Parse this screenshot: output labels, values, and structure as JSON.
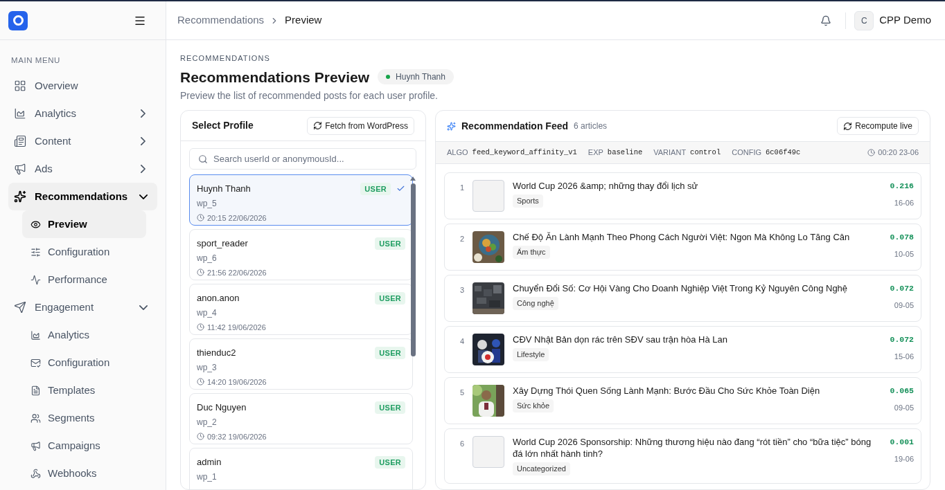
{
  "topbar": {
    "breadcrumbs": [
      {
        "label": "Recommendations",
        "current": false
      },
      {
        "label": "Preview",
        "current": true
      }
    ],
    "avatar_initial": "C",
    "user_name": "CPP Demo"
  },
  "sidebar": {
    "section_title": "MAIN MENU",
    "items": [
      {
        "label": "Overview",
        "kind": "link",
        "selected": false
      },
      {
        "label": "Analytics",
        "kind": "group",
        "expanded": false,
        "selected": false
      },
      {
        "label": "Content",
        "kind": "group",
        "expanded": false,
        "selected": false
      },
      {
        "label": "Ads",
        "kind": "group",
        "expanded": false,
        "selected": false
      },
      {
        "label": "Recommendations",
        "kind": "group",
        "expanded": true,
        "selected": true,
        "children": [
          {
            "label": "Preview",
            "selected": true
          },
          {
            "label": "Configuration",
            "selected": false
          },
          {
            "label": "Performance",
            "selected": false
          }
        ]
      },
      {
        "label": "Engagement",
        "kind": "group",
        "expanded": true,
        "selected": false,
        "children": [
          {
            "label": "Analytics",
            "selected": false
          },
          {
            "label": "Configuration",
            "selected": false
          },
          {
            "label": "Templates",
            "selected": false
          },
          {
            "label": "Segments",
            "selected": false
          },
          {
            "label": "Campaigns",
            "selected": false
          },
          {
            "label": "Webhooks",
            "selected": false
          }
        ]
      }
    ]
  },
  "page": {
    "eyebrow": "RECOMMENDATIONS",
    "title": "Recommendations Preview",
    "profile_badge": "Huynh Thanh",
    "description": "Preview the list of recommended posts for each user profile."
  },
  "profiles_panel": {
    "title": "Select Profile",
    "fetch_button": "Fetch from WordPress",
    "search": {
      "placeholder": "Search userId or anonymousId..."
    },
    "profiles": [
      {
        "name": "Huynh Thanh",
        "role": "USER",
        "id": "wp_5",
        "time": "20:15 22/06/2026",
        "selected": true
      },
      {
        "name": "sport_reader",
        "role": "USER",
        "id": "wp_6",
        "time": "21:56 22/06/2026",
        "selected": false
      },
      {
        "name": "anon.anon",
        "role": "USER",
        "id": "wp_4",
        "time": "11:42 19/06/2026",
        "selected": false
      },
      {
        "name": "thienduc2",
        "role": "USER",
        "id": "wp_3",
        "time": "14:20 19/06/2026",
        "selected": false
      },
      {
        "name": "Duc Nguyen",
        "role": "USER",
        "id": "wp_2",
        "time": "09:32 19/06/2026",
        "selected": false
      },
      {
        "name": "admin",
        "role": "USER",
        "id": "wp_1",
        "selected": false
      }
    ]
  },
  "feed": {
    "title": "Recommendation Feed",
    "count": "6 articles",
    "recompute_button": "Recompute live",
    "meta": [
      {
        "label": "ALGO",
        "value": "feed_keyword_affinity_v1"
      },
      {
        "label": "EXP",
        "value": "baseline"
      },
      {
        "label": "VARIANT",
        "value": "control"
      },
      {
        "label": "CONFIG",
        "value": "6c06f49c"
      }
    ],
    "computed_at": "00:20 23-06",
    "articles": [
      {
        "rank": "1",
        "title": "World Cup 2026 &amp; những thay đổi lịch sử",
        "category": "Sports",
        "score": "0.216",
        "date": "16-06",
        "kind": "placeholder"
      },
      {
        "rank": "2",
        "title": "Chế Độ Ăn Lành Mạnh Theo Phong Cách Người Việt: Ngon Mà Không Lo Tăng Cân",
        "category": "Ẩm thực",
        "score": "0.078",
        "date": "10-05",
        "kind": "picture"
      },
      {
        "rank": "3",
        "title": "Chuyển Đổi Số: Cơ Hội Vàng Cho Doanh Nghiệp Việt Trong Kỷ Nguyên Công Nghệ",
        "category": "Công nghệ",
        "score": "0.072",
        "date": "09-05",
        "kind": "picture"
      },
      {
        "rank": "4",
        "title": "CĐV Nhật Bản dọn rác trên SĐV sau trận hòa Hà Lan",
        "category": "Lifestyle",
        "score": "0.072",
        "date": "15-06",
        "kind": "picture"
      },
      {
        "rank": "5",
        "title": "Xây Dựng Thói Quen Sống Lành Mạnh: Bước Đầu Cho Sức Khỏe Toàn Diện",
        "category": "Sức khỏe",
        "score": "0.065",
        "date": "09-05",
        "kind": "picture"
      },
      {
        "rank": "6",
        "title": "World Cup 2026 Sponsorship: Những thương hiệu nào đang “rót tiền” cho “bữa tiệc” bóng đá lớn nhất hành tinh?",
        "category": "Uncategorized",
        "score": "0.001",
        "date": "19-06",
        "kind": "placeholder"
      }
    ]
  }
}
